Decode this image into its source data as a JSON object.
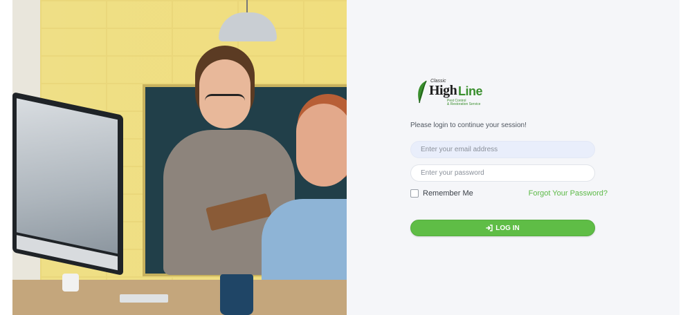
{
  "logo": {
    "small_text": "Classic",
    "main_text": "High",
    "accent_text": "Line",
    "subtext_1": "Pest Control",
    "subtext_2": "& Restoration Service"
  },
  "login": {
    "prompt": "Please login to continue your session!",
    "email_placeholder": "Enter your email address",
    "password_placeholder": "Enter your password",
    "remember_label": "Remember Me",
    "forgot_label": "Forgot Your Password?",
    "login_button_label": "LOG IN"
  },
  "colors": {
    "accent_green": "#5fbd46",
    "panel_background": "#f5f6f9",
    "email_background": "#e9eefb"
  },
  "icons": {
    "login_icon": "sign-in-icon",
    "logo_icon": "leaf-icon"
  }
}
